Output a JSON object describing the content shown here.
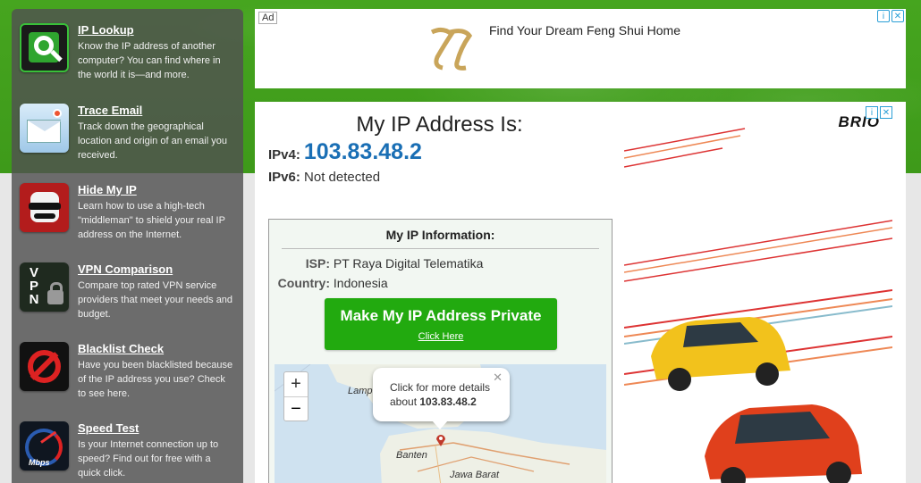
{
  "sidebar": {
    "items": [
      {
        "title": "IP Lookup",
        "desc": "Know the IP address of another computer? You can find where in the world it is—and more.",
        "icon": "magnifier-ip-icon"
      },
      {
        "title": "Trace Email",
        "desc": "Track down the geographical location and origin of an email you received.",
        "icon": "email-map-icon"
      },
      {
        "title": "Hide My IP",
        "desc": "Learn how to use a high-tech \"middleman\" to shield your real IP address on the Internet.",
        "icon": "disguise-icon"
      },
      {
        "title": "VPN Comparison",
        "desc": "Compare top rated VPN service providers that meet your needs and budget.",
        "icon": "vpn-lock-icon"
      },
      {
        "title": "Blacklist Check",
        "desc": "Have you been blacklisted because of the IP address you use? Check to see here.",
        "icon": "no-ip-icon"
      },
      {
        "title": "Speed Test",
        "desc": "Is your Internet connection up to speed? Find out for free with a quick click.",
        "icon": "speedometer-icon"
      }
    ]
  },
  "ad_top": {
    "label": "Ad",
    "text": "Find Your Dream Feng Shui Home",
    "choices": [
      "i",
      "✕"
    ]
  },
  "main": {
    "heading": "My IP Address Is:",
    "ipv4_label": "IPv4:",
    "ipv4_value": "103.83.48.2",
    "ipv6_label": "IPv6:",
    "ipv6_value": "Not detected"
  },
  "info": {
    "title": "My IP Information:",
    "isp_label": "ISP:",
    "isp_value": "PT Raya Digital Telematika",
    "country_label": "Country:",
    "country_value": "Indonesia",
    "cta_main": "Make My IP Address Private",
    "cta_sub": "Click Here"
  },
  "map": {
    "zoom_in": "+",
    "zoom_out": "−",
    "popup_line1": "Click for more details",
    "popup_line2_prefix": "about ",
    "popup_ip": "103.83.48.2",
    "close": "✕",
    "labels": [
      "Lampung",
      "Banten",
      "Jawa Barat"
    ]
  },
  "ad_right": {
    "brand": "BRIO",
    "choices": [
      "i",
      "✕"
    ]
  },
  "colors": {
    "header_green": "#46a51f",
    "ip_blue": "#1a6fb5",
    "cta_green": "#22aa0f",
    "sidebar_bg": "#505050"
  }
}
